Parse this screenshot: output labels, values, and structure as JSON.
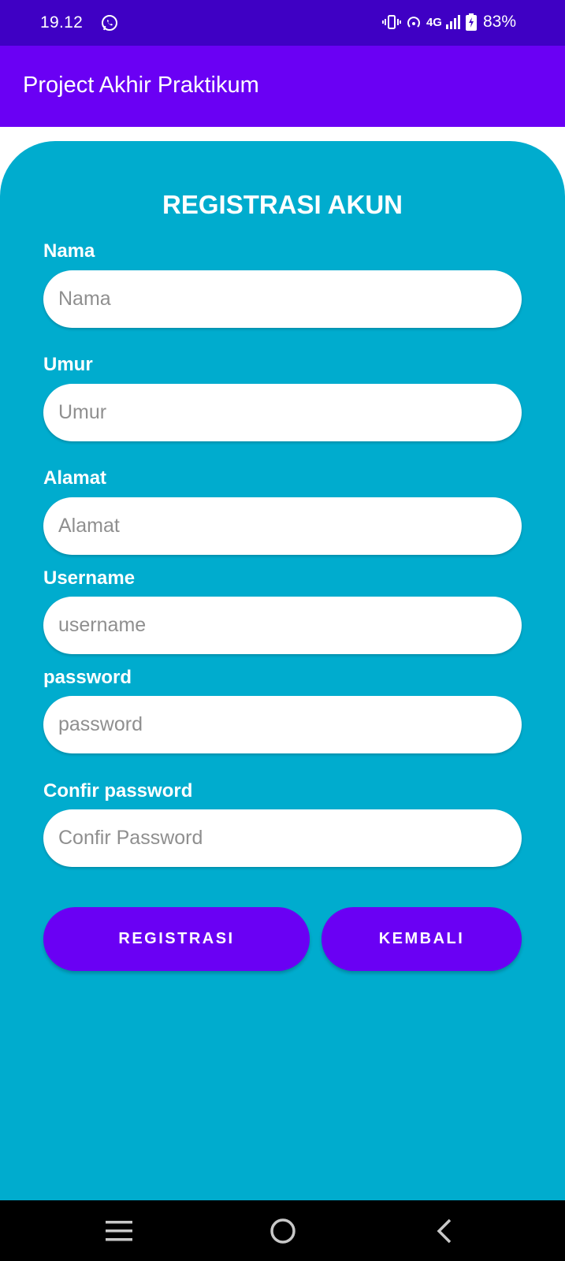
{
  "status_bar": {
    "time": "19.12",
    "network": "4G",
    "battery": "83%",
    "icons": [
      "whatsapp-icon",
      "vibrate-icon",
      "hotspot-icon",
      "signal-icon",
      "battery-charging-icon"
    ]
  },
  "app_bar": {
    "title": "Project Akhir Praktikum"
  },
  "form": {
    "title": "REGISTRASI AKUN",
    "fields": [
      {
        "label": "Nama",
        "placeholder": "Nama",
        "value": ""
      },
      {
        "label": "Umur",
        "placeholder": "Umur",
        "value": ""
      },
      {
        "label": "Alamat",
        "placeholder": "Alamat",
        "value": ""
      },
      {
        "label": "Username",
        "placeholder": "username",
        "value": ""
      },
      {
        "label": "password",
        "placeholder": "password",
        "value": ""
      },
      {
        "label": "Confir password",
        "placeholder": "Confir Password",
        "value": ""
      }
    ],
    "buttons": {
      "register": "REGISTRASI",
      "back": "KEMBALI"
    }
  },
  "nav_bar": {
    "icons": [
      "recent-apps-icon",
      "home-icon",
      "back-icon"
    ]
  },
  "colors": {
    "status_bar": "#3f00c4",
    "app_bar": "#6a00f4",
    "card": "#00acce",
    "button": "#6a00f4",
    "input_bg": "#ffffff",
    "nav_bar": "#000000"
  }
}
